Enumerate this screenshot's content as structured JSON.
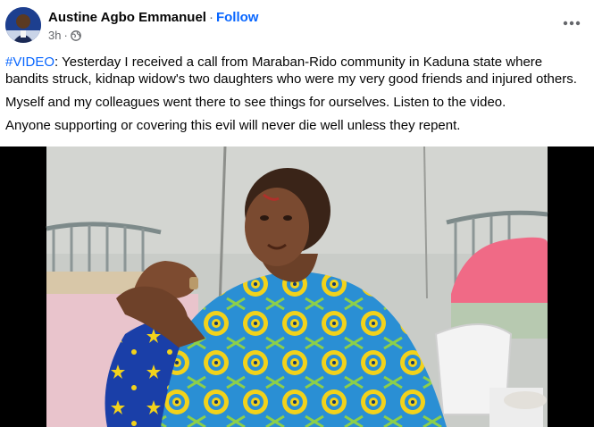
{
  "post": {
    "author": "Austine Agbo Emmanuel",
    "separator": "·",
    "follow_label": "Follow",
    "timestamp": "3h",
    "timestamp_separator": "·",
    "privacy_icon": "globe-icon",
    "more_icon": "more-horizontal-icon",
    "text": {
      "hashtag": "#VIDEO",
      "p1": ": Yesterday I received a call from Maraban-Rido community in Kaduna state where bandits struck, kidnap widow's two daughters who were my very good friends and injured others.",
      "p2": "Myself and my colleagues went there to see things for ourselves. Listen to the video.",
      "p3": "Anyone supporting or covering this evil will never die well unless they repent."
    }
  },
  "colors": {
    "link_blue": "#0866ff",
    "secondary_text": "#65676b",
    "headwrap_blue": "#2a8fd4",
    "fabric_yellow": "#f2d21b"
  }
}
